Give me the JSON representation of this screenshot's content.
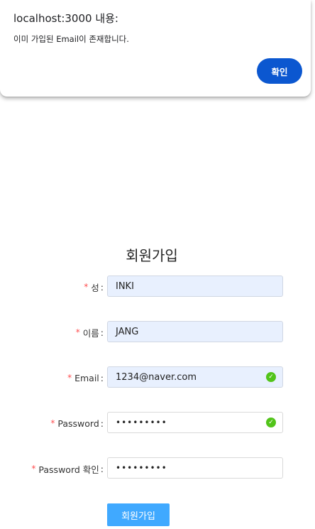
{
  "dialog": {
    "title": "localhost:3000 내용:",
    "message": "이미 가입된 Email이 존재합니다.",
    "ok_label": "확인"
  },
  "form": {
    "title": "회원가입",
    "required_mark": "*",
    "colon": ":",
    "fields": {
      "last_name": {
        "label": "성",
        "value": "INKI"
      },
      "first_name": {
        "label": "이름",
        "value": "JANG"
      },
      "email": {
        "label": "Email",
        "value": "1234@naver.com"
      },
      "password": {
        "label": "Password",
        "value": "•••••••••"
      },
      "password_confirm": {
        "label": "Password 확인",
        "value": "•••••••••"
      }
    },
    "submit_label": "회원가입"
  },
  "icons": {
    "valid": "check-circle-icon"
  },
  "colors": {
    "dialog_button": "#0b57d0",
    "submit_button": "#40a9ff",
    "required": "#ff4d4f",
    "valid": "#52c41a",
    "autofill_bg": "#e8f0fe"
  }
}
